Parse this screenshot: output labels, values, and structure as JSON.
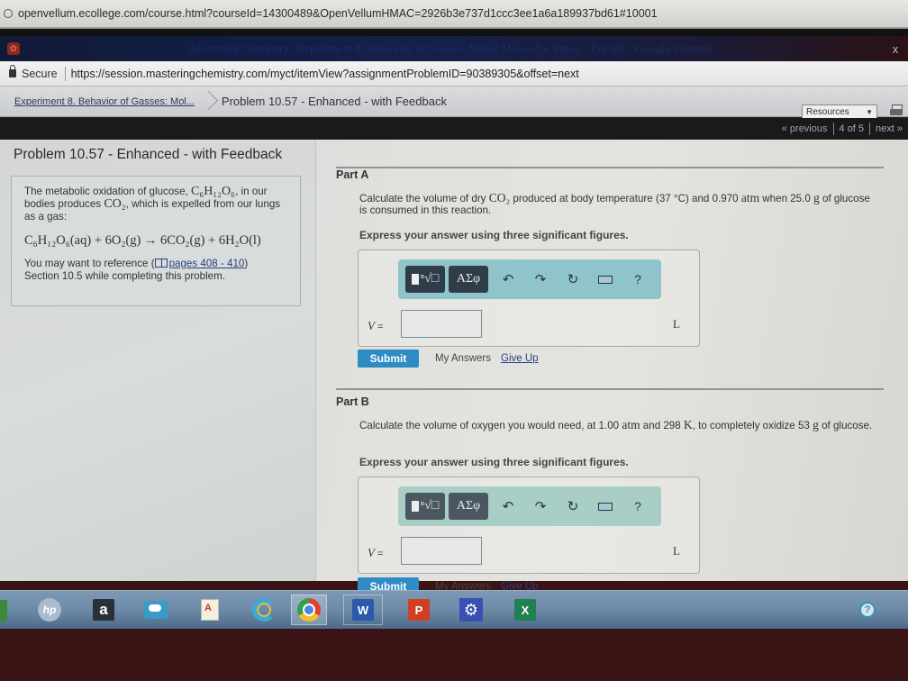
{
  "background_window": {
    "url": "openvellum.ecollege.com/course.html?courseId=14300489&OpenVellumHMAC=2926b3e737d1ccc3ee1a6a189937bd61#10001"
  },
  "window": {
    "title": "MasteringChemistry: Experiment 8. Behavior of Gasses: Molar Mass of a Vapor - Pre lab - Google Chrome",
    "close_label": "x"
  },
  "address_bar": {
    "secure_label": "Secure",
    "url": "https://session.masteringchemistry.com/myct/itemView?assignmentProblemID=90389305&offset=next"
  },
  "breadcrumb": {
    "parent": "Experiment 8. Behavior of Gasses: Mol...",
    "current": "Problem 10.57 - Enhanced - with Feedback"
  },
  "resources": {
    "label": "Resources",
    "caret": "▼"
  },
  "pager": {
    "previous": "« previous",
    "position": "4 of 5",
    "next": "next »"
  },
  "problem": {
    "title": "Problem 10.57 - Enhanced - with Feedback",
    "intro_1": "The metabolic oxidation of glucose, ",
    "glucose": "C₆H₁₂O₆",
    "intro_2": ", in our bodies produces ",
    "co2": "CO₂",
    "intro_3": ", which is expelled from our lungs as a gas:",
    "equation": "C₆H₁₂O₆(aq) + 6O₂(g) → 6CO₂(g) + 6H₂O(l)",
    "ref_prefix": "You may want to reference (",
    "ref_link": "pages 408 - 410",
    "ref_suffix": ")",
    "ref_line2": "Section 10.5 while completing this problem."
  },
  "toolbar": {
    "template_label": "ⁿ√□",
    "greek_label": "ΑΣφ",
    "undo": "↶",
    "redo": "↷",
    "reset": "↻",
    "help": "?"
  },
  "parts": [
    {
      "title": "Part A",
      "q1": "Calculate the volume of dry ",
      "q_co2": "CO₂",
      "q2": " produced at body temperature (37 °C) and 0.970 ",
      "q_atm": "atm",
      "q3": " when 25.0 ",
      "q_g": "g",
      "q4": " of glucose is consumed in this reaction.",
      "express": "Express your answer using three significant figures.",
      "variable": "V",
      "equals": " =",
      "value": "",
      "unit": "L",
      "submit": "Submit",
      "my_answers": "My Answers",
      "give_up": "Give Up"
    },
    {
      "title": "Part B",
      "q1": "Calculate the volume of oxygen you would need, at 1.00 ",
      "q_atm": "atm",
      "q2": " and 298 ",
      "q_K": "K",
      "q3": ", to completely oxidize 53 ",
      "q_g": "g",
      "q4": " of glucose.",
      "express": "Express your answer using three significant figures.",
      "variable": "V",
      "equals": " =",
      "value": "",
      "unit": "L",
      "submit": "Submit",
      "my_answers": "My Answers",
      "give_up": "Give Up"
    }
  ],
  "taskbar": {
    "hp": "hp",
    "amazon": "a",
    "word": "W",
    "powerpoint": "P",
    "settings": "⚙",
    "excel": "X",
    "help": "?"
  }
}
